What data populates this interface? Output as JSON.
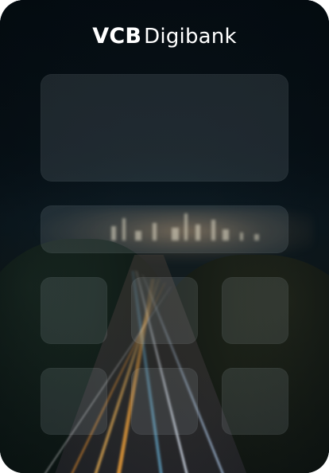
{
  "app": {
    "logo": {
      "brand": "VCB",
      "product": "Digibank"
    }
  },
  "placeholders": {
    "hero_card": "",
    "banner_card": "",
    "tiles": [
      "",
      "",
      "",
      "",
      "",
      ""
    ]
  }
}
